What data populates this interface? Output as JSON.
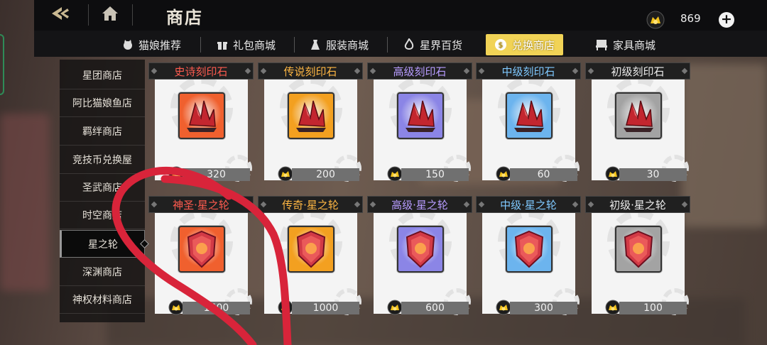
{
  "header": {
    "title": "商店",
    "currency_value": "869",
    "back_icon": "back-arrow-icon",
    "home_icon": "home-icon",
    "plus_label": "+"
  },
  "tabs": [
    {
      "label": "猫娘推荐",
      "icon": "cat-icon"
    },
    {
      "label": "礼包商城",
      "icon": "gift-icon"
    },
    {
      "label": "服装商城",
      "icon": "dress-icon"
    },
    {
      "label": "星界百货",
      "icon": "flame-icon"
    },
    {
      "label": "兑换商店",
      "icon": "coin-icon",
      "active": true
    },
    {
      "label": "家具商城",
      "icon": "furniture-icon"
    }
  ],
  "sidebar": {
    "items": [
      {
        "label": "星团商店"
      },
      {
        "label": "阿比猫娘鱼店"
      },
      {
        "label": "羁绊商店"
      },
      {
        "label": "竞技币兑换屋"
      },
      {
        "label": "圣武商店"
      },
      {
        "label": "时空商店"
      },
      {
        "label": "星之轮",
        "active": true
      },
      {
        "label": "深渊商店"
      },
      {
        "label": "神权材料商店"
      }
    ]
  },
  "cards": [
    {
      "name": "史诗刻印石",
      "price": "320",
      "color": "#ff5b4f",
      "bg": "#f0602e",
      "kind": "crystal"
    },
    {
      "name": "传说刻印石",
      "price": "200",
      "color": "#ffb743",
      "bg": "#f3a020",
      "kind": "crystal"
    },
    {
      "name": "高级刻印石",
      "price": "150",
      "color": "#b79cff",
      "bg": "#8b85e6",
      "kind": "crystal"
    },
    {
      "name": "中级刻印石",
      "price": "60",
      "color": "#7fc9ff",
      "bg": "#6cb4ee",
      "kind": "crystal"
    },
    {
      "name": "初级刻印石",
      "price": "30",
      "color": "#ececec",
      "bg": "#a3a3a3",
      "kind": "crystal"
    },
    {
      "name": "神圣·星之轮",
      "price": "1500",
      "color": "#ff5b4f",
      "bg": "#f0602e",
      "kind": "shield"
    },
    {
      "name": "传奇·星之轮",
      "price": "1000",
      "color": "#ffb743",
      "bg": "#f3a020",
      "kind": "shield"
    },
    {
      "name": "高级·星之轮",
      "price": "600",
      "color": "#b79cff",
      "bg": "#8b85e6",
      "kind": "shield"
    },
    {
      "name": "中级·星之轮",
      "price": "300",
      "color": "#7fc9ff",
      "bg": "#6cb4ee",
      "kind": "shield"
    },
    {
      "name": "初级·星之轮",
      "price": "100",
      "color": "#ececec",
      "bg": "#a3a3a3",
      "kind": "shield"
    }
  ],
  "colors": {
    "active_tab": "#f1d356",
    "scribble": "#d8243a"
  }
}
